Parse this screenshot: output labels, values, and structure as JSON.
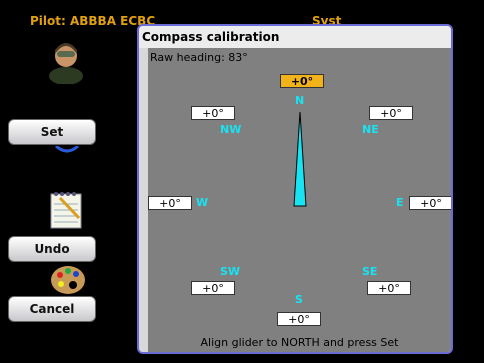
{
  "background": {
    "pilot_label": "Pilot: ABBBA ECBC",
    "status_label": "Syst",
    "buttons": {
      "set": "Set",
      "undo": "Undo",
      "cancel": "Cancel"
    }
  },
  "dialog": {
    "title": "Compass calibration",
    "raw_heading": "Raw heading: 83°",
    "footer": "Align glider to NORTH and press Set",
    "directions": {
      "n": "N",
      "ne": "NE",
      "e": "E",
      "se": "SE",
      "s": "S",
      "sw": "SW",
      "w": "W",
      "nw": "NW"
    },
    "offsets": {
      "n": "+0°",
      "ne": "+0°",
      "e": "+0°",
      "se": "+0°",
      "s": "+0°",
      "sw": "+0°",
      "w": "+0°",
      "nw": "+0°"
    },
    "active_direction": "n"
  },
  "colors": {
    "accent": "#f2b21a",
    "direction_text": "#17e3f3",
    "needle_fill": "#17e3f3",
    "dialog_border": "#6b6bd8"
  }
}
